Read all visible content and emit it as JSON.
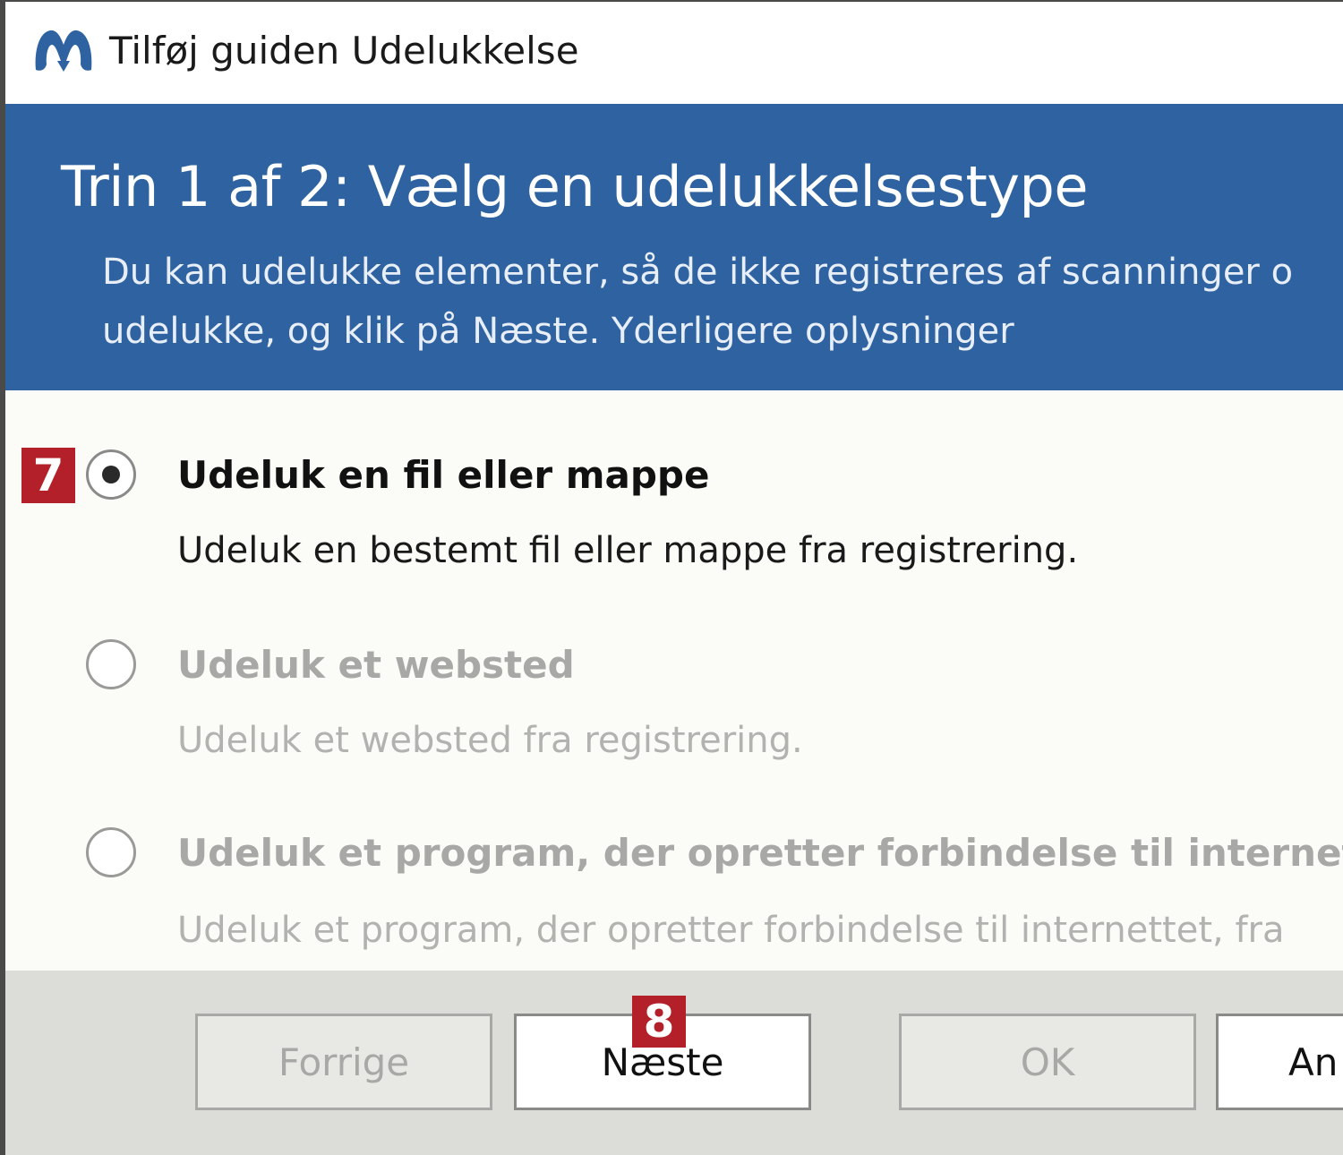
{
  "window": {
    "title": "Tilføj guiden Udelukkelse",
    "brand_color": "#2e62a0"
  },
  "banner": {
    "title": "Trin 1 af 2: Vælg en udelukkelsestype",
    "description_line1": "Du kan udelukke elementer, så de ikke registreres af scanninger o",
    "description_line2": "udelukke, og klik på Næste. Yderligere oplysninger"
  },
  "options": [
    {
      "label": "Udeluk en fil eller mappe",
      "description": "Udeluk en bestemt fil eller mappe fra registrering.",
      "selected": true
    },
    {
      "label": "Udeluk et websted",
      "description": "Udeluk et websted fra registrering.",
      "selected": false
    },
    {
      "label": "Udeluk et program, der opretter forbindelse til internet",
      "description": "Udeluk et program, der opretter forbindelse til internettet, fra",
      "selected": false
    }
  ],
  "annotations": {
    "step7": "7",
    "step8": "8",
    "color": "#b3202a"
  },
  "buttons": {
    "previous": "Forrige",
    "next": "Næste",
    "ok": "OK",
    "cancel": "An"
  }
}
